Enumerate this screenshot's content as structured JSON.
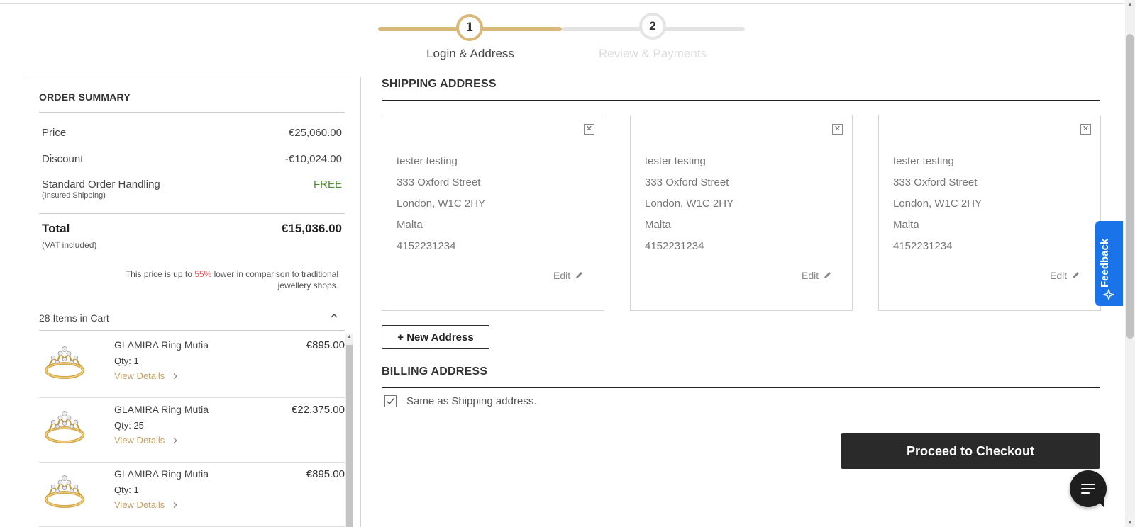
{
  "progress": {
    "step1_number": "1",
    "step1_label": "Login & Address",
    "step2_number": "2",
    "step2_label": "Review & Payments"
  },
  "summary": {
    "title": "ORDER SUMMARY",
    "price_label": "Price",
    "price_value": "€25,060.00",
    "discount_label": "Discount",
    "discount_value": "-€10,024.00",
    "handling_label": "Standard Order Handling",
    "handling_sub": "(Insured Shipping)",
    "handling_value": "FREE",
    "total_label": "Total",
    "total_value": "€15,036.00",
    "vat_label": "(VAT included)",
    "note_prefix": "This price is up to ",
    "note_pct": "55%",
    "note_suffix": " lower in comparison to traditional jewellery shops.",
    "cart_header": "28 Items in Cart",
    "items": [
      {
        "name": "GLAMIRA Ring Mutia",
        "qty": "Qty: 1",
        "link": "View Details",
        "price": "€895.00"
      },
      {
        "name": "GLAMIRA Ring Mutia",
        "qty": "Qty: 25",
        "link": "View Details",
        "price": "€22,375.00"
      },
      {
        "name": "GLAMIRA Ring Mutia",
        "qty": "Qty: 1",
        "link": "View Details",
        "price": "€895.00"
      }
    ]
  },
  "shipping": {
    "title": "SHIPPING ADDRESS",
    "cards": [
      {
        "name": "tester testing",
        "street": "333 Oxford Street",
        "city": "London, W1C 2HY",
        "country": "Malta",
        "phone": "4152231234",
        "edit": "Edit"
      },
      {
        "name": "tester testing",
        "street": "333 Oxford Street",
        "city": "London, W1C 2HY",
        "country": "Malta",
        "phone": "4152231234",
        "edit": "Edit"
      },
      {
        "name": "tester testing",
        "street": "333 Oxford Street",
        "city": "London, W1C 2HY",
        "country": "Malta",
        "phone": "4152231234",
        "edit": "Edit"
      }
    ],
    "new_address_label": "+ New Address"
  },
  "billing": {
    "title": "BILLING ADDRESS",
    "same_label": "Same as Shipping address.",
    "same_checked": true
  },
  "checkout_label": "Proceed to Checkout",
  "feedback_label": "Feedback",
  "colors": {
    "gold": "#d9b87a",
    "link_gold": "#c3a06a",
    "free_green": "#4b8b2c",
    "pct_red": "#e4545f",
    "feedback_blue": "#1a73e8",
    "checkout_bg": "#2a2a2a"
  },
  "icons": {
    "close": "close-icon",
    "edit": "pencil-icon",
    "chevron_up": "chevron-up-icon",
    "chevron_right": "chevron-right-icon",
    "check": "checkmark-icon",
    "chat": "chat-icon",
    "feedback": "sparkle-icon"
  }
}
